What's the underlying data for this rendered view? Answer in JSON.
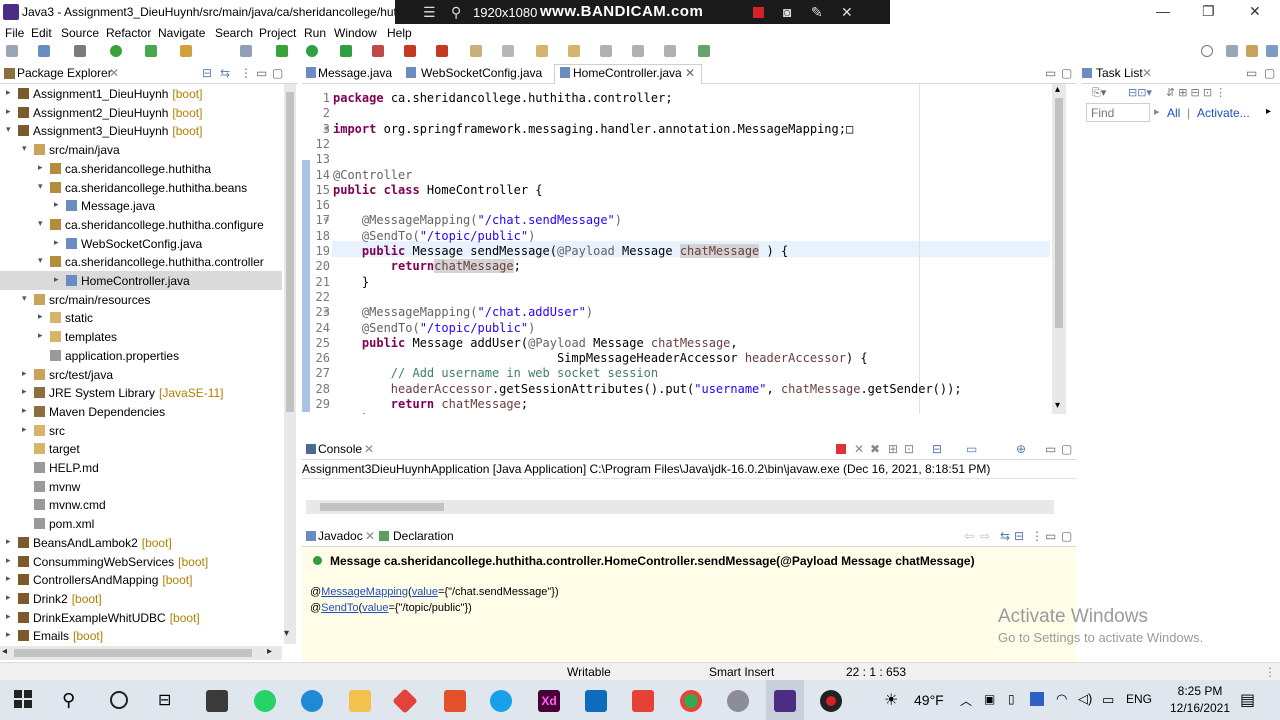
{
  "window": {
    "title": "Java3 - Assignment3_DieuHuynh/src/main/java/ca/sheridancollege/huthi",
    "min": "—",
    "max": "❐",
    "close": "✕"
  },
  "bandicam": {
    "resolution": "1920x1080",
    "brand": "www.BANDICAM.com"
  },
  "menu": [
    "File",
    "Edit",
    "Source",
    "Refactor",
    "Navigate",
    "Search",
    "Project",
    "Run",
    "Window",
    "Help"
  ],
  "package_explorer": {
    "title": "Package Explorer",
    "tree": [
      {
        "label": "Assignment1_DieuHuynh",
        "suffix": "[boot]",
        "indent": 0,
        "arrow": "▸",
        "icon": "project"
      },
      {
        "label": "Assignment2_DieuHuynh",
        "suffix": "[boot]",
        "indent": 0,
        "arrow": "▸",
        "icon": "project"
      },
      {
        "label": "Assignment3_DieuHuynh",
        "suffix": "[boot]",
        "indent": 0,
        "arrow": "▾",
        "icon": "project"
      },
      {
        "label": "src/main/java",
        "suffix": "",
        "indent": 1,
        "arrow": "▾",
        "icon": "srcfolder"
      },
      {
        "label": "ca.sheridancollege.huthitha",
        "suffix": "",
        "indent": 2,
        "arrow": "▸",
        "icon": "package"
      },
      {
        "label": "ca.sheridancollege.huthitha.beans",
        "suffix": "",
        "indent": 2,
        "arrow": "▾",
        "icon": "package"
      },
      {
        "label": "Message.java",
        "suffix": "",
        "indent": 3,
        "arrow": "▸",
        "icon": "java"
      },
      {
        "label": "ca.sheridancollege.huthitha.configure",
        "suffix": "",
        "indent": 2,
        "arrow": "▾",
        "icon": "package"
      },
      {
        "label": "WebSocketConfig.java",
        "suffix": "",
        "indent": 3,
        "arrow": "▸",
        "icon": "java"
      },
      {
        "label": "ca.sheridancollege.huthitha.controller",
        "suffix": "",
        "indent": 2,
        "arrow": "▾",
        "icon": "package"
      },
      {
        "label": "HomeController.java",
        "suffix": "",
        "indent": 3,
        "arrow": "▸",
        "icon": "java",
        "selected": true
      },
      {
        "label": "src/main/resources",
        "suffix": "",
        "indent": 1,
        "arrow": "▾",
        "icon": "srcfolder"
      },
      {
        "label": "static",
        "suffix": "",
        "indent": 2,
        "arrow": "▸",
        "icon": "folder"
      },
      {
        "label": "templates",
        "suffix": "",
        "indent": 2,
        "arrow": "▸",
        "icon": "folder"
      },
      {
        "label": "application.properties",
        "suffix": "",
        "indent": 2,
        "arrow": "",
        "icon": "file"
      },
      {
        "label": "src/test/java",
        "suffix": "",
        "indent": 1,
        "arrow": "▸",
        "icon": "srcfolder"
      },
      {
        "label": "JRE System Library",
        "suffix": "[JavaSE-11]",
        "indent": 1,
        "arrow": "▸",
        "icon": "lib"
      },
      {
        "label": "Maven Dependencies",
        "suffix": "",
        "indent": 1,
        "arrow": "▸",
        "icon": "lib"
      },
      {
        "label": "src",
        "suffix": "",
        "indent": 1,
        "arrow": "▸",
        "icon": "folder"
      },
      {
        "label": "target",
        "suffix": "",
        "indent": 1,
        "arrow": "",
        "icon": "folder"
      },
      {
        "label": "HELP.md",
        "suffix": "",
        "indent": 1,
        "arrow": "",
        "icon": "file"
      },
      {
        "label": "mvnw",
        "suffix": "",
        "indent": 1,
        "arrow": "",
        "icon": "file"
      },
      {
        "label": "mvnw.cmd",
        "suffix": "",
        "indent": 1,
        "arrow": "",
        "icon": "file"
      },
      {
        "label": "pom.xml",
        "suffix": "",
        "indent": 1,
        "arrow": "",
        "icon": "file"
      },
      {
        "label": "BeansAndLambok2",
        "suffix": "[boot]",
        "indent": 0,
        "arrow": "▸",
        "icon": "project"
      },
      {
        "label": "ConsummingWebServices",
        "suffix": "[boot]",
        "indent": 0,
        "arrow": "▸",
        "icon": "project"
      },
      {
        "label": "ControllersAndMapping",
        "suffix": "[boot]",
        "indent": 0,
        "arrow": "▸",
        "icon": "project"
      },
      {
        "label": "Drink2",
        "suffix": "[boot]",
        "indent": 0,
        "arrow": "▸",
        "icon": "project"
      },
      {
        "label": "DrinkExampleWhitUDBC",
        "suffix": "[boot]",
        "indent": 0,
        "arrow": "▸",
        "icon": "project"
      },
      {
        "label": "Emails",
        "suffix": "[boot]",
        "indent": 0,
        "arrow": "▸",
        "icon": "project"
      }
    ]
  },
  "editor": {
    "tabs": [
      "Message.java",
      "WebSocketConfig.java",
      "HomeController.java"
    ],
    "lines": [
      {
        "n": "1",
        "marker": "",
        "tokens": [
          [
            "kw",
            "package"
          ],
          [
            "",
            "ca.sheridancollege.huthitha.controller;"
          ]
        ]
      },
      {
        "n": "2",
        "marker": "",
        "tokens": []
      },
      {
        "n": "3",
        "marker": "⊕",
        "tokens": [
          [
            "kw",
            "import"
          ],
          [
            "",
            "org.springframework.messaging.handler.annotation.MessageMapping;□"
          ]
        ]
      },
      {
        "n": "12",
        "marker": "",
        "tokens": []
      },
      {
        "n": "13",
        "marker": "",
        "tokens": []
      },
      {
        "n": "14",
        "marker": "",
        "tokens": [
          [
            "ann",
            "@Controller"
          ]
        ]
      },
      {
        "n": "15",
        "marker": "",
        "tokens": [
          [
            "kw",
            "public class"
          ],
          [
            "",
            " HomeController {"
          ]
        ]
      },
      {
        "n": "16",
        "marker": "",
        "tokens": []
      },
      {
        "n": "17",
        "marker": "⊖",
        "tokens": [
          [
            "",
            "    "
          ],
          [
            "ann",
            "@MessageMapping("
          ],
          [
            "str",
            "\"/chat.sendMessage\""
          ],
          [
            "ann",
            ")"
          ]
        ]
      },
      {
        "n": "18",
        "marker": "",
        "tokens": [
          [
            "",
            "    "
          ],
          [
            "ann",
            "@SendTo("
          ],
          [
            "str",
            "\"/topic/public\""
          ],
          [
            "ann",
            ")"
          ]
        ]
      },
      {
        "n": "19",
        "marker": "",
        "tokens": [
          [
            "",
            "    "
          ],
          [
            "kw",
            "public"
          ],
          [
            "",
            " Message sendMessage("
          ],
          [
            "ann",
            "@Payload"
          ],
          [
            "",
            " Message "
          ],
          [
            "varh",
            "chatMessage"
          ],
          [
            "",
            " ) {"
          ]
        ]
      },
      {
        "n": "20",
        "marker": "",
        "tokens": [
          [
            "",
            "        "
          ],
          [
            "kw",
            "return"
          ],
          [
            " ",
            ""
          ],
          [
            "varh",
            "chatMessage"
          ],
          [
            "",
            ";"
          ]
        ]
      },
      {
        "n": "21",
        "marker": "",
        "tokens": [
          [
            "",
            "    }"
          ]
        ]
      },
      {
        "n": "22",
        "marker": "",
        "tokens": []
      },
      {
        "n": "23",
        "marker": "⊖",
        "tokens": [
          [
            "",
            "    "
          ],
          [
            "ann",
            "@MessageMapping("
          ],
          [
            "str",
            "\"/chat.addUser\""
          ],
          [
            "ann",
            ")"
          ]
        ]
      },
      {
        "n": "24",
        "marker": "",
        "tokens": [
          [
            "",
            "    "
          ],
          [
            "ann",
            "@SendTo("
          ],
          [
            "str",
            "\"/topic/public\""
          ],
          [
            "ann",
            ")"
          ]
        ]
      },
      {
        "n": "25",
        "marker": "",
        "tokens": [
          [
            "",
            "    "
          ],
          [
            "kw",
            "public"
          ],
          [
            "",
            " Message addUser("
          ],
          [
            "ann",
            "@Payload"
          ],
          [
            "",
            " Message "
          ],
          [
            "var",
            "chatMessage"
          ],
          [
            "",
            ","
          ]
        ]
      },
      {
        "n": "26",
        "marker": "",
        "tokens": [
          [
            "",
            "                               SimpMessageHeaderAccessor "
          ],
          [
            "var",
            "headerAccessor"
          ],
          [
            "",
            ") {"
          ]
        ]
      },
      {
        "n": "27",
        "marker": "",
        "tokens": [
          [
            "",
            "        "
          ],
          [
            "cmt",
            "// Add username in web socket session"
          ]
        ]
      },
      {
        "n": "28",
        "marker": "",
        "tokens": [
          [
            "",
            "        "
          ],
          [
            "var",
            "headerAccessor"
          ],
          [
            "",
            ".getSessionAttributes().put("
          ],
          [
            "str",
            "\"username\""
          ],
          [
            "",
            ", "
          ],
          [
            "var",
            "chatMessage"
          ],
          [
            "",
            ".getSender());"
          ]
        ]
      },
      {
        "n": "29",
        "marker": "",
        "tokens": [
          [
            "",
            "        "
          ],
          [
            "kw",
            "return"
          ],
          [
            "",
            " "
          ],
          [
            "var",
            "chatMessage"
          ],
          [
            "",
            ";"
          ]
        ]
      },
      {
        "n": "30",
        "marker": "",
        "tokens": [
          [
            "",
            "    }"
          ]
        ]
      }
    ]
  },
  "console": {
    "tab": "Console",
    "launch": "Assignment3DieuHuynhApplication [Java Application] C:\\Program Files\\Java\\jdk-16.0.2\\bin\\javaw.exe  (Dec 16, 2021, 8:18:51 PM)"
  },
  "javadoc": {
    "tabs": [
      "Javadoc",
      "Declaration"
    ],
    "signature": "Message ca.sheridancollege.huthitha.controller.HomeController.sendMessage(@Payload Message chatMessage)",
    "ann1_name": "MessageMapping",
    "ann1_key": "value",
    "ann1_val": "={\"/chat.sendMessage\"})",
    "ann2_name": "SendTo",
    "ann2_key": "value",
    "ann2_val": "={\"/topic/public\"})"
  },
  "tasklist": {
    "title": "Task List",
    "find_placeholder": "Find",
    "all": "All",
    "activate": "Activate..."
  },
  "watermark": {
    "line1": "Activate Windows",
    "line2": "Go to Settings to activate Windows."
  },
  "status": {
    "mode": "Writable",
    "insert": "Smart Insert",
    "position": "22 : 1 : 653"
  },
  "taskbar": {
    "temperature": "49°F",
    "lang": "ENG",
    "time": "8:25 PM",
    "date": "12/16/2021"
  },
  "colors": {
    "accent": "#0078d4",
    "keyword": "#7f0055",
    "string": "#2a00ff",
    "record": "#d4212a"
  }
}
